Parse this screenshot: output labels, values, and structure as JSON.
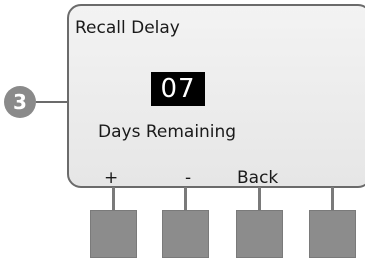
{
  "screen": {
    "title": "Recall Delay",
    "value": "07",
    "value_label": "Days Remaining"
  },
  "callout": {
    "number": "3"
  },
  "softkeys": {
    "key1": "+",
    "key2": "-",
    "key3": "Back",
    "key4": ""
  },
  "colors": {
    "lcd_background": "#ebebeb",
    "lcd_border": "#6b6b6b",
    "button_fill": "#8c8c8c",
    "callout_fill": "#8a8a8a",
    "highlight_fill": "#000000",
    "highlight_text": "#ffffff"
  }
}
